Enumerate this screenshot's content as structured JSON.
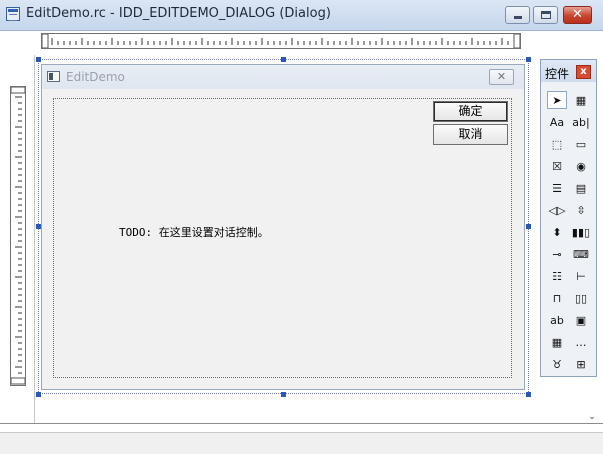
{
  "window": {
    "title": "EditDemo.rc - IDD_EDITDEMO_DIALOG (Dialog)",
    "minimize_icon": "minimize-icon",
    "maximize_icon": "maximize-icon",
    "close_icon": "close-icon",
    "close_glyph": "✕"
  },
  "dialog": {
    "title": "EditDemo",
    "close_glyph": "✕",
    "ok_label": "确定",
    "cancel_label": "取消",
    "todo_text": "TODO: 在这里设置对话控制。"
  },
  "toolbox": {
    "title": "控件",
    "close_glyph": "x",
    "tools": [
      {
        "name": "pointer-icon",
        "glyph": "➤"
      },
      {
        "name": "picture-control-icon",
        "glyph": "▦"
      },
      {
        "name": "static-text-icon",
        "glyph": "Aa"
      },
      {
        "name": "edit-control-icon",
        "glyph": "ab|"
      },
      {
        "name": "group-box-icon",
        "glyph": "⬚"
      },
      {
        "name": "button-icon",
        "glyph": "▭"
      },
      {
        "name": "check-box-icon",
        "glyph": "☒"
      },
      {
        "name": "radio-button-icon",
        "glyph": "◉"
      },
      {
        "name": "combo-box-icon",
        "glyph": "☰"
      },
      {
        "name": "list-box-icon",
        "glyph": "▤"
      },
      {
        "name": "horizontal-scrollbar-icon",
        "glyph": "◁▷"
      },
      {
        "name": "vertical-scrollbar-icon",
        "glyph": "⇳"
      },
      {
        "name": "spin-control-icon",
        "glyph": "⬍"
      },
      {
        "name": "progress-control-icon",
        "glyph": "▮▮▯"
      },
      {
        "name": "slider-control-icon",
        "glyph": "⊸"
      },
      {
        "name": "hot-key-icon",
        "glyph": "⌨"
      },
      {
        "name": "list-control-icon",
        "glyph": "☷"
      },
      {
        "name": "tree-control-icon",
        "glyph": "⊢"
      },
      {
        "name": "tab-control-icon",
        "glyph": "⊓"
      },
      {
        "name": "animation-control-icon",
        "glyph": "▯▯"
      },
      {
        "name": "rich-edit-icon",
        "glyph": "ab"
      },
      {
        "name": "date-time-picker-icon",
        "glyph": "▣"
      },
      {
        "name": "month-calendar-icon",
        "glyph": "▦"
      },
      {
        "name": "ip-address-icon",
        "glyph": "…"
      },
      {
        "name": "extended-combo-icon",
        "glyph": "♉"
      },
      {
        "name": "custom-control-icon",
        "glyph": "⊞"
      }
    ]
  }
}
